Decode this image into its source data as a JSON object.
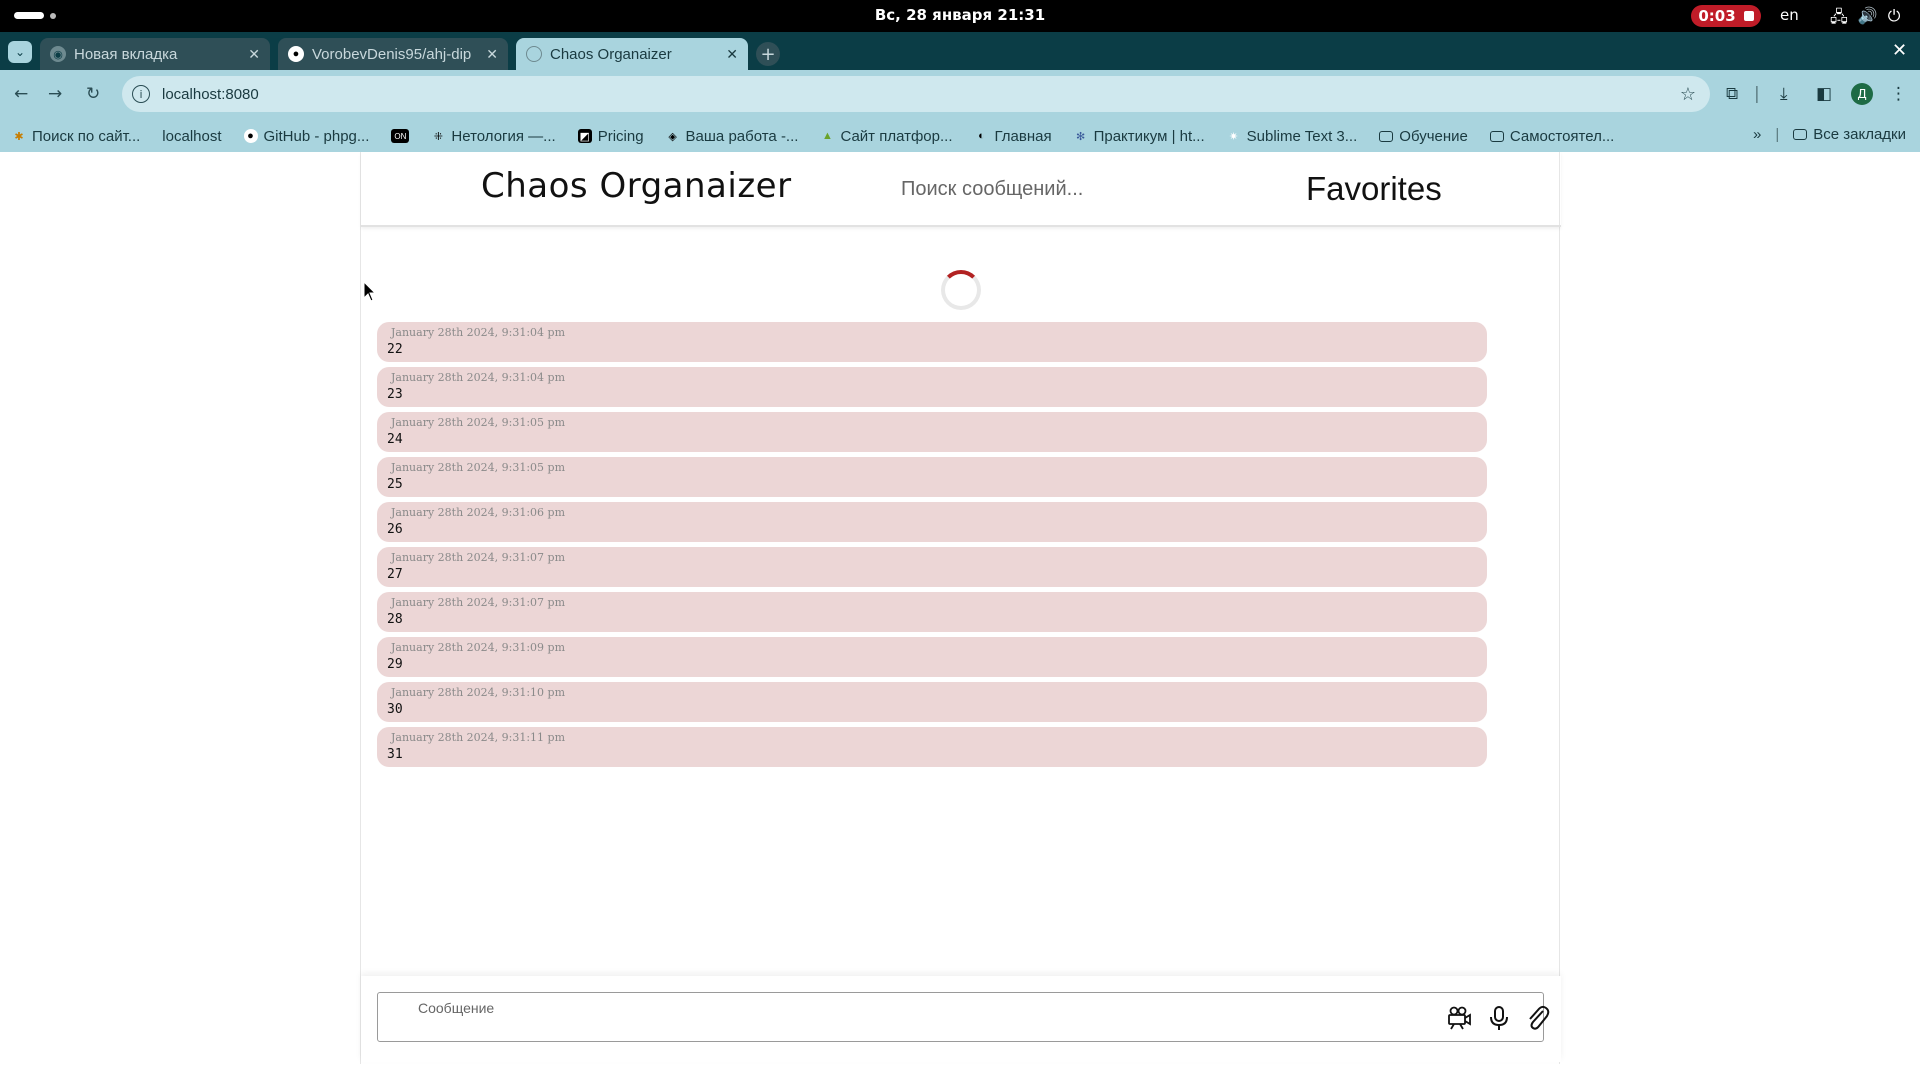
{
  "system": {
    "clock": "Вс, 28 января  21:31",
    "recording_time": "0:03",
    "language": "en"
  },
  "tabs": [
    {
      "label": "Новая вкладка",
      "active": false
    },
    {
      "label": "VorobevDenis95/ahj-dip",
      "active": false
    },
    {
      "label": "Chaos Organaizer",
      "active": true
    }
  ],
  "toolbar": {
    "url": "localhost:8080",
    "profile_initial": "Д"
  },
  "bookmarks": [
    {
      "label": "Поиск по сайт...",
      "icon": "puzzle-icon"
    },
    {
      "label": "localhost",
      "icon": "blank"
    },
    {
      "label": "GitHub - phpg...",
      "icon": "github-icon"
    },
    {
      "label": "",
      "icon": "on-icon"
    },
    {
      "label": "Нетология —...",
      "icon": "netology-icon"
    },
    {
      "label": "Pricing",
      "icon": "pricing-icon"
    },
    {
      "label": "Ваша работа -...",
      "icon": "work-icon"
    },
    {
      "label": "Сайт платфор...",
      "icon": "platform-icon"
    },
    {
      "label": "Главная",
      "icon": "globe-icon"
    },
    {
      "label": "Практикум | ht...",
      "icon": "gear-icon"
    },
    {
      "label": "Sublime Text 3...",
      "icon": "sublime-icon"
    },
    {
      "label": "Обучение",
      "icon": "folder-icon"
    },
    {
      "label": "Самостоятел...",
      "icon": "folder-icon"
    }
  ],
  "bookmarks_all": "Все закладки",
  "app": {
    "title": "Chaos Organaizer",
    "search_placeholder": "Поиск сообщений...",
    "favorites_label": "Favorites",
    "input_placeholder": "Сообщение"
  },
  "messages": [
    {
      "date": "January 28th 2024, 9:31:04 pm",
      "text": "22"
    },
    {
      "date": "January 28th 2024, 9:31:04 pm",
      "text": "23"
    },
    {
      "date": "January 28th 2024, 9:31:05 pm",
      "text": "24"
    },
    {
      "date": "January 28th 2024, 9:31:05 pm",
      "text": "25"
    },
    {
      "date": "January 28th 2024, 9:31:06 pm",
      "text": "26"
    },
    {
      "date": "January 28th 2024, 9:31:07 pm",
      "text": "27"
    },
    {
      "date": "January 28th 2024, 9:31:07 pm",
      "text": "28"
    },
    {
      "date": "January 28th 2024, 9:31:09 pm",
      "text": "29"
    },
    {
      "date": "January 28th 2024, 9:31:10 pm",
      "text": "30"
    },
    {
      "date": "January 28th 2024, 9:31:11 pm",
      "text": "31"
    }
  ],
  "colors": {
    "message_bg": "#ecd6d6",
    "spinner_accent": "#b22222",
    "chrome_frame": "#a9d4de",
    "tabstrip": "#0b3d46",
    "record": "#c01c28"
  }
}
